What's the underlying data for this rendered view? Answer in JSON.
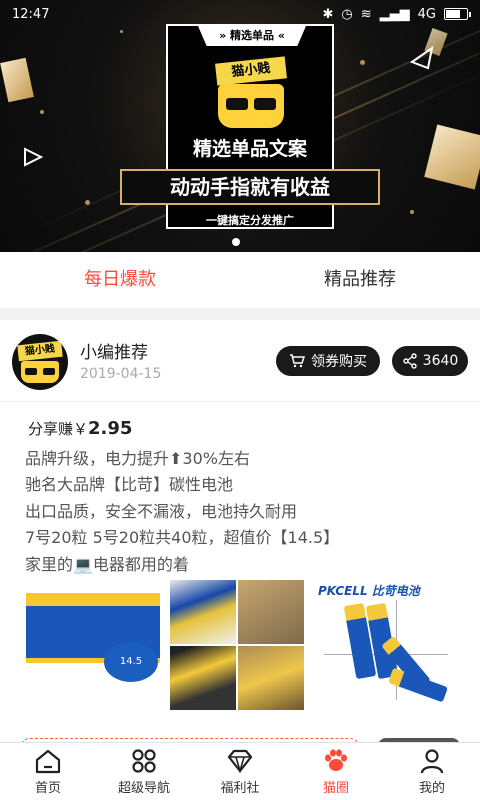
{
  "status_bar": {
    "time": "12:47",
    "network": "4G"
  },
  "banner": {
    "tag": "» 精选单品 «",
    "logo_text": "猫小贱",
    "title": "精选单品文案",
    "ribbon": "动动手指就有收益",
    "subtitle": "一键搞定分发推广"
  },
  "tabs": [
    {
      "label": "每日爆款",
      "active": true
    },
    {
      "label": "精品推荐",
      "active": false
    }
  ],
  "post": {
    "avatar_text": "猫小贱",
    "author": "小编推荐",
    "date": "2019-04-15",
    "coupon_button": "领券购买",
    "share_count": "3640",
    "earn_label": "分享赚￥",
    "earn_value": "2.95",
    "description": [
      "品牌升级，电力提升⬆30%左右",
      "驰名大品牌【比苛】碳性电池",
      "出口品质，安全不漏液，电池持久耐用",
      "7号20粒 5号20粒共40粒，超值价【14.5】",
      "家里的💻电器都用的着"
    ],
    "image1_badge": "14.5",
    "image3_brand": "PKCELL 比苛电池"
  },
  "nav": [
    {
      "label": "首页",
      "icon": "home-icon",
      "active": false
    },
    {
      "label": "超级导航",
      "icon": "grid-icon",
      "active": false
    },
    {
      "label": "福利社",
      "icon": "diamond-icon",
      "active": false
    },
    {
      "label": "猫圈",
      "icon": "paw-icon",
      "active": true
    },
    {
      "label": "我的",
      "icon": "user-icon",
      "active": false
    }
  ],
  "colors": {
    "accent": "#ff4a3a",
    "dark_button": "#1a1a1a",
    "gold": "#d9b066"
  }
}
